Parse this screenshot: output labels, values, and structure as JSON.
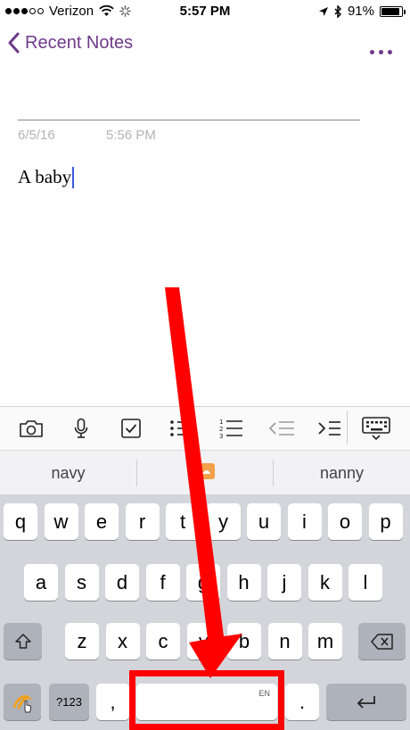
{
  "status_bar": {
    "carrier": "Verizon",
    "time": "5:57 PM",
    "battery": "91%",
    "battery_level": 0.91,
    "signal_bars_filled": 3,
    "signal_bars_total": 5
  },
  "nav": {
    "back_label": "Recent Notes",
    "accent_color": "#6e3a8a"
  },
  "note": {
    "date": "6/5/16",
    "time": "5:56 PM",
    "body": "A baby",
    "cursor_color": "#3a5ad9"
  },
  "toolbar": {
    "icons": [
      "camera-icon",
      "microphone-icon",
      "checkbox-icon",
      "bullet-list-icon",
      "numbered-list-icon",
      "outdent-icon",
      "indent-icon",
      "keyboard-dismiss-icon"
    ]
  },
  "suggestions": {
    "left": "navy",
    "middle_icon": "emoji-suggestion-icon",
    "right": "nanny"
  },
  "keyboard": {
    "row1": [
      "q",
      "w",
      "e",
      "r",
      "t",
      "y",
      "u",
      "i",
      "o",
      "p"
    ],
    "row2": [
      "a",
      "s",
      "d",
      "f",
      "g",
      "h",
      "j",
      "k",
      "l"
    ],
    "row3": [
      "z",
      "x",
      "c",
      "v",
      "b",
      "n",
      "m"
    ],
    "numbers_key": "?123",
    "comma_key": ",",
    "period_key": ".",
    "space_language": "EN",
    "swype_icon": "swype-logo-icon",
    "shift_icon": "shift-icon",
    "backspace_icon": "backspace-icon",
    "return_icon": "return-icon"
  },
  "annotation": {
    "color": "#ff0000",
    "highlight": "space bar"
  }
}
